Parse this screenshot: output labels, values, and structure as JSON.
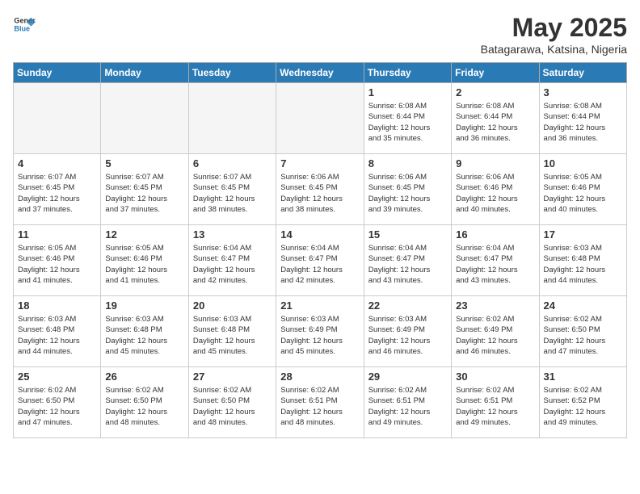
{
  "header": {
    "logo_general": "General",
    "logo_blue": "Blue",
    "month": "May 2025",
    "location": "Batagarawa, Katsina, Nigeria"
  },
  "weekdays": [
    "Sunday",
    "Monday",
    "Tuesday",
    "Wednesday",
    "Thursday",
    "Friday",
    "Saturday"
  ],
  "weeks": [
    [
      {
        "day": "",
        "info": ""
      },
      {
        "day": "",
        "info": ""
      },
      {
        "day": "",
        "info": ""
      },
      {
        "day": "",
        "info": ""
      },
      {
        "day": "1",
        "info": "Sunrise: 6:08 AM\nSunset: 6:44 PM\nDaylight: 12 hours\nand 35 minutes."
      },
      {
        "day": "2",
        "info": "Sunrise: 6:08 AM\nSunset: 6:44 PM\nDaylight: 12 hours\nand 36 minutes."
      },
      {
        "day": "3",
        "info": "Sunrise: 6:08 AM\nSunset: 6:44 PM\nDaylight: 12 hours\nand 36 minutes."
      }
    ],
    [
      {
        "day": "4",
        "info": "Sunrise: 6:07 AM\nSunset: 6:45 PM\nDaylight: 12 hours\nand 37 minutes."
      },
      {
        "day": "5",
        "info": "Sunrise: 6:07 AM\nSunset: 6:45 PM\nDaylight: 12 hours\nand 37 minutes."
      },
      {
        "day": "6",
        "info": "Sunrise: 6:07 AM\nSunset: 6:45 PM\nDaylight: 12 hours\nand 38 minutes."
      },
      {
        "day": "7",
        "info": "Sunrise: 6:06 AM\nSunset: 6:45 PM\nDaylight: 12 hours\nand 38 minutes."
      },
      {
        "day": "8",
        "info": "Sunrise: 6:06 AM\nSunset: 6:45 PM\nDaylight: 12 hours\nand 39 minutes."
      },
      {
        "day": "9",
        "info": "Sunrise: 6:06 AM\nSunset: 6:46 PM\nDaylight: 12 hours\nand 40 minutes."
      },
      {
        "day": "10",
        "info": "Sunrise: 6:05 AM\nSunset: 6:46 PM\nDaylight: 12 hours\nand 40 minutes."
      }
    ],
    [
      {
        "day": "11",
        "info": "Sunrise: 6:05 AM\nSunset: 6:46 PM\nDaylight: 12 hours\nand 41 minutes."
      },
      {
        "day": "12",
        "info": "Sunrise: 6:05 AM\nSunset: 6:46 PM\nDaylight: 12 hours\nand 41 minutes."
      },
      {
        "day": "13",
        "info": "Sunrise: 6:04 AM\nSunset: 6:47 PM\nDaylight: 12 hours\nand 42 minutes."
      },
      {
        "day": "14",
        "info": "Sunrise: 6:04 AM\nSunset: 6:47 PM\nDaylight: 12 hours\nand 42 minutes."
      },
      {
        "day": "15",
        "info": "Sunrise: 6:04 AM\nSunset: 6:47 PM\nDaylight: 12 hours\nand 43 minutes."
      },
      {
        "day": "16",
        "info": "Sunrise: 6:04 AM\nSunset: 6:47 PM\nDaylight: 12 hours\nand 43 minutes."
      },
      {
        "day": "17",
        "info": "Sunrise: 6:03 AM\nSunset: 6:48 PM\nDaylight: 12 hours\nand 44 minutes."
      }
    ],
    [
      {
        "day": "18",
        "info": "Sunrise: 6:03 AM\nSunset: 6:48 PM\nDaylight: 12 hours\nand 44 minutes."
      },
      {
        "day": "19",
        "info": "Sunrise: 6:03 AM\nSunset: 6:48 PM\nDaylight: 12 hours\nand 45 minutes."
      },
      {
        "day": "20",
        "info": "Sunrise: 6:03 AM\nSunset: 6:48 PM\nDaylight: 12 hours\nand 45 minutes."
      },
      {
        "day": "21",
        "info": "Sunrise: 6:03 AM\nSunset: 6:49 PM\nDaylight: 12 hours\nand 45 minutes."
      },
      {
        "day": "22",
        "info": "Sunrise: 6:03 AM\nSunset: 6:49 PM\nDaylight: 12 hours\nand 46 minutes."
      },
      {
        "day": "23",
        "info": "Sunrise: 6:02 AM\nSunset: 6:49 PM\nDaylight: 12 hours\nand 46 minutes."
      },
      {
        "day": "24",
        "info": "Sunrise: 6:02 AM\nSunset: 6:50 PM\nDaylight: 12 hours\nand 47 minutes."
      }
    ],
    [
      {
        "day": "25",
        "info": "Sunrise: 6:02 AM\nSunset: 6:50 PM\nDaylight: 12 hours\nand 47 minutes."
      },
      {
        "day": "26",
        "info": "Sunrise: 6:02 AM\nSunset: 6:50 PM\nDaylight: 12 hours\nand 48 minutes."
      },
      {
        "day": "27",
        "info": "Sunrise: 6:02 AM\nSunset: 6:50 PM\nDaylight: 12 hours\nand 48 minutes."
      },
      {
        "day": "28",
        "info": "Sunrise: 6:02 AM\nSunset: 6:51 PM\nDaylight: 12 hours\nand 48 minutes."
      },
      {
        "day": "29",
        "info": "Sunrise: 6:02 AM\nSunset: 6:51 PM\nDaylight: 12 hours\nand 49 minutes."
      },
      {
        "day": "30",
        "info": "Sunrise: 6:02 AM\nSunset: 6:51 PM\nDaylight: 12 hours\nand 49 minutes."
      },
      {
        "day": "31",
        "info": "Sunrise: 6:02 AM\nSunset: 6:52 PM\nDaylight: 12 hours\nand 49 minutes."
      }
    ]
  ]
}
